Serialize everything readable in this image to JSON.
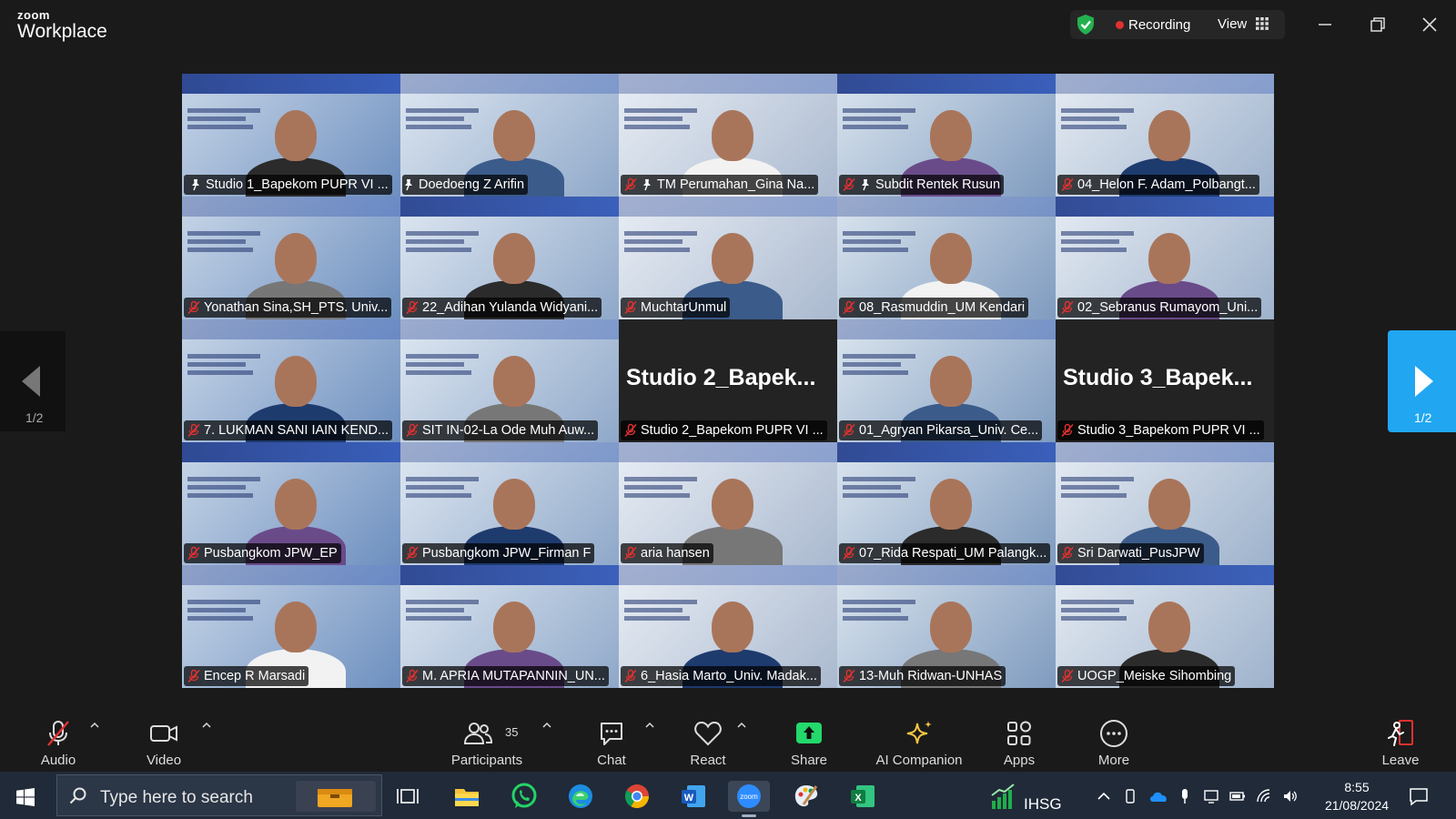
{
  "app": {
    "brand_top": "zoom",
    "brand_main": "Workplace",
    "recording_label": "Recording",
    "view_label": "View"
  },
  "pagination": {
    "prev_label": "1/2",
    "next_label": "1/2"
  },
  "participants": [
    {
      "name": "Studio 1_Bapekom PUPR VI ...",
      "pinned": true,
      "active": true,
      "type": "video"
    },
    {
      "name": "Doedoeng Z Arifin",
      "pinned": true,
      "muted": false,
      "type": "video"
    },
    {
      "name": "TM Perumahan_Gina Na...",
      "pinned": true,
      "muted": true,
      "type": "video"
    },
    {
      "name": "Subdit Rentek Rusun",
      "pinned": true,
      "muted": true,
      "type": "video"
    },
    {
      "name": "04_Helon F. Adam_Polbangt...",
      "muted": true,
      "type": "video"
    },
    {
      "name": "Yonathan Sina,SH_PTS. Univ...",
      "muted": true,
      "type": "video"
    },
    {
      "name": "22_Adihan Yulanda Widyani...",
      "muted": true,
      "type": "video"
    },
    {
      "name": "MuchtarUnmul",
      "muted": true,
      "type": "video"
    },
    {
      "name": "08_Rasmuddin_UM Kendari",
      "muted": true,
      "type": "video"
    },
    {
      "name": "02_Sebranus Rumayom_Uni...",
      "muted": true,
      "type": "video"
    },
    {
      "name": "7. LUKMAN SANI IAIN KEND...",
      "muted": true,
      "type": "video"
    },
    {
      "name": "SIT IN-02-La Ode Muh Auw...",
      "muted": true,
      "type": "video"
    },
    {
      "name": "Studio 2_Bapekom PUPR VI ...",
      "muted": true,
      "type": "name",
      "big": "Studio  2_Bapek..."
    },
    {
      "name": "01_Agryan Pikarsa_Univ. Ce...",
      "muted": true,
      "type": "video"
    },
    {
      "name": "Studio 3_Bapekom PUPR VI ...",
      "muted": true,
      "type": "name",
      "big": "Studio  3_Bapek..."
    },
    {
      "name": "Pusbangkom JPW_EP",
      "muted": true,
      "type": "video"
    },
    {
      "name": "Pusbangkom JPW_Firman F",
      "muted": true,
      "type": "video"
    },
    {
      "name": "aria hansen",
      "muted": true,
      "type": "video"
    },
    {
      "name": "07_Rida Respati_UM Palangk...",
      "muted": true,
      "type": "video"
    },
    {
      "name": "Sri Darwati_PusJPW",
      "muted": true,
      "type": "video"
    },
    {
      "name": "Encep R Marsadi",
      "muted": true,
      "type": "video"
    },
    {
      "name": "M. APRIA MUTAPANNIN_UN...",
      "muted": true,
      "type": "video"
    },
    {
      "name": "6_Hasia Marto_Univ. Madak...",
      "muted": true,
      "type": "video"
    },
    {
      "name": "13-Muh Ridwan-UNHAS",
      "muted": true,
      "type": "video"
    },
    {
      "name": "UOGP_Meiske Sihombing",
      "muted": true,
      "type": "video"
    }
  ],
  "toolbar": {
    "audio": "Audio",
    "video": "Video",
    "participants": "Participants",
    "participants_count": "35",
    "chat": "Chat",
    "react": "React",
    "share": "Share",
    "ai_companion": "AI Companion",
    "apps": "Apps",
    "more": "More",
    "leave": "Leave"
  },
  "taskbar": {
    "search_placeholder": "Type here to search",
    "ticker": "IHSG",
    "time": "8:55",
    "date": "21/08/2024",
    "apps": [
      "task-view-icon",
      "file-explorer-icon",
      "whatsapp-icon",
      "edge-icon",
      "chrome-icon",
      "word-icon",
      "zoom-icon",
      "paint-icon",
      "excel-icon"
    ]
  },
  "colors": {
    "active_speaker": "#23d96b",
    "share_green": "#23d96b",
    "leave_red": "#e0312f",
    "next_page_blue": "#21a6f2",
    "recording_red": "#e0312f"
  }
}
